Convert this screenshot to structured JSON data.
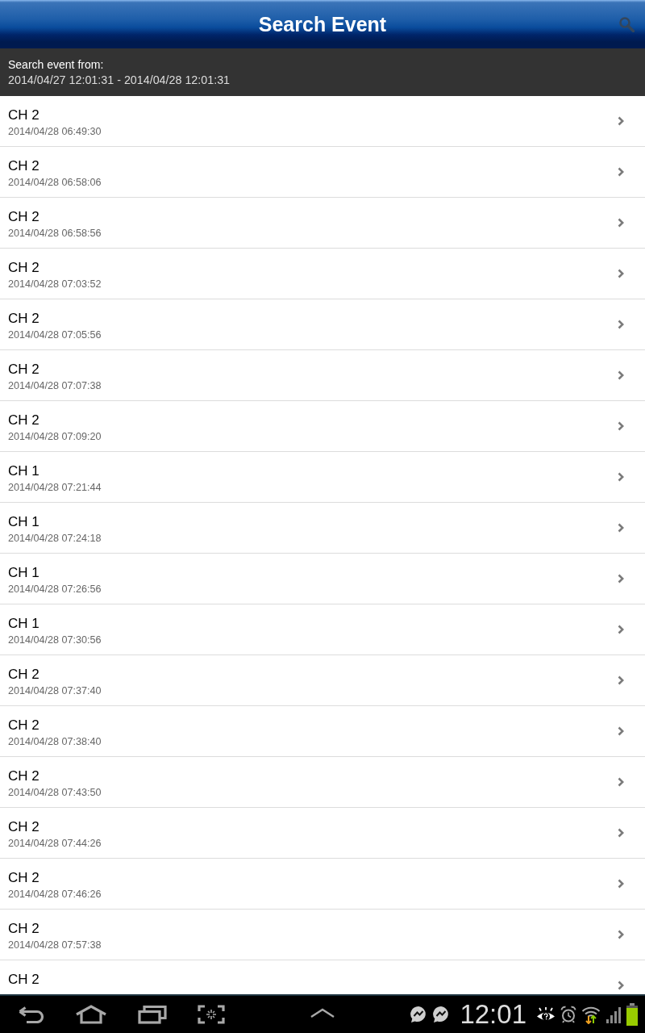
{
  "app_bar": {
    "title": "Search Event"
  },
  "search_range": {
    "label": "Search event from:",
    "range": "2014/04/27 12:01:31 - 2014/04/28 12:01:31"
  },
  "events": [
    {
      "channel": "CH 2",
      "time": "2014/04/28 06:49:30"
    },
    {
      "channel": "CH 2",
      "time": "2014/04/28 06:58:06"
    },
    {
      "channel": "CH 2",
      "time": "2014/04/28 06:58:56"
    },
    {
      "channel": "CH 2",
      "time": "2014/04/28 07:03:52"
    },
    {
      "channel": "CH 2",
      "time": "2014/04/28 07:05:56"
    },
    {
      "channel": "CH 2",
      "time": "2014/04/28 07:07:38"
    },
    {
      "channel": "CH 2",
      "time": "2014/04/28 07:09:20"
    },
    {
      "channel": "CH 1",
      "time": "2014/04/28 07:21:44"
    },
    {
      "channel": "CH 1",
      "time": "2014/04/28 07:24:18"
    },
    {
      "channel": "CH 1",
      "time": "2014/04/28 07:26:56"
    },
    {
      "channel": "CH 1",
      "time": "2014/04/28 07:30:56"
    },
    {
      "channel": "CH 2",
      "time": "2014/04/28 07:37:40"
    },
    {
      "channel": "CH 2",
      "time": "2014/04/28 07:38:40"
    },
    {
      "channel": "CH 2",
      "time": "2014/04/28 07:43:50"
    },
    {
      "channel": "CH 2",
      "time": "2014/04/28 07:44:26"
    },
    {
      "channel": "CH 2",
      "time": "2014/04/28 07:46:26"
    },
    {
      "channel": "CH 2",
      "time": "2014/04/28 07:57:38"
    },
    {
      "channel": "CH 2"
    }
  ],
  "system_bar": {
    "time": "12:01"
  }
}
